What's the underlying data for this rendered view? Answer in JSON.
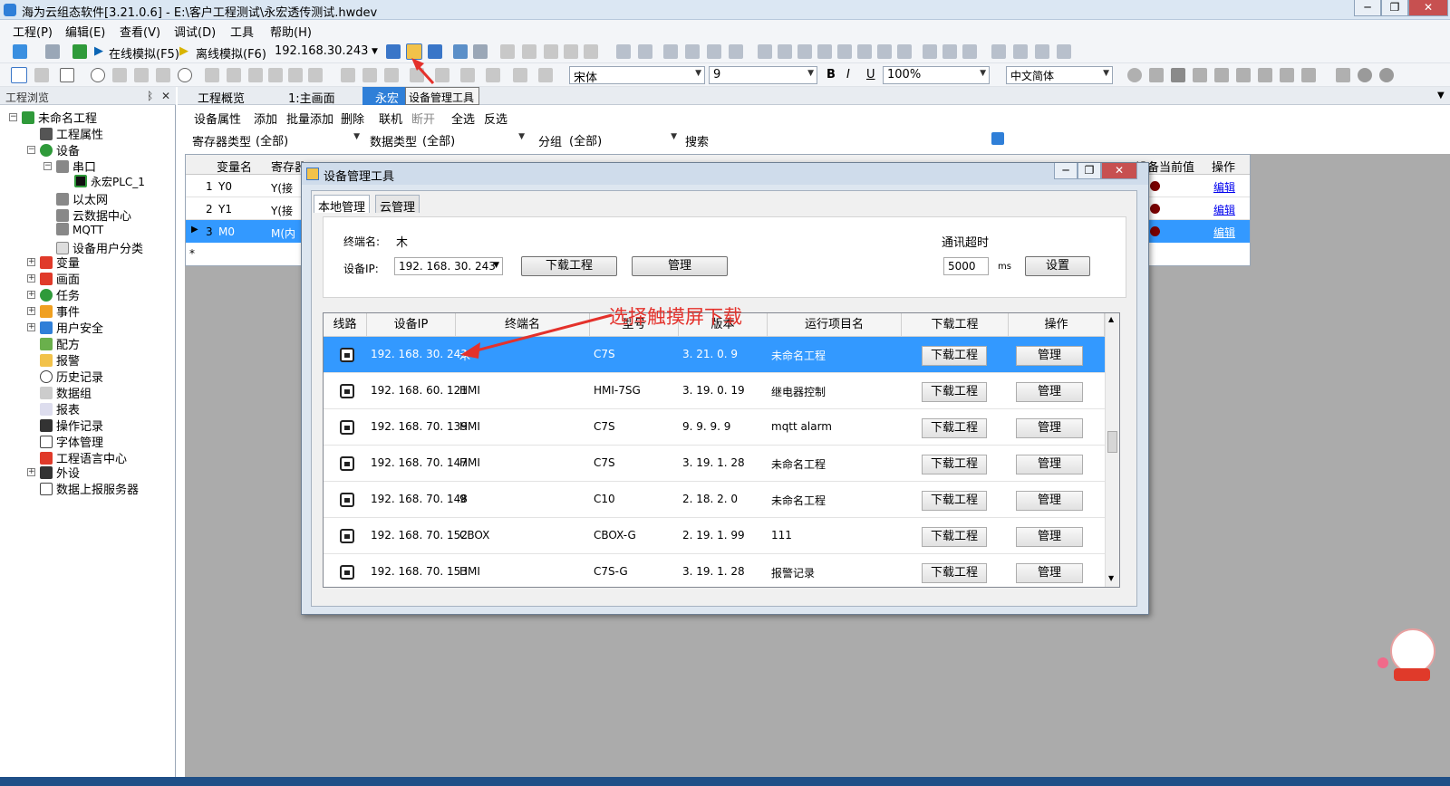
{
  "app": {
    "title": "海为云组态软件[3.21.0.6] - E:\\客户工程测试\\永宏透传测试.hwdev"
  },
  "menu": [
    "工程(P)",
    "编辑(E)",
    "查看(V)",
    "调试(D)",
    "工具",
    "帮助(H)"
  ],
  "toolbar": {
    "online_sim": "在线模拟(F5)",
    "offline_sim": "离线模拟(F6)",
    "ip": "192.168.30.243",
    "font_name": "宋体",
    "font_size": "9",
    "zoom": "100%",
    "language": "中文简体",
    "tooltip": "设备管理工具"
  },
  "left_panel": {
    "title": "工程浏览",
    "tree": [
      "未命名工程",
      "工程属性",
      "设备",
      "串口",
      "永宏PLC_1",
      "以太网",
      "云数据中心",
      "MQTT",
      "设备用户分类",
      "变量",
      "画面",
      "任务",
      "事件",
      "用户安全",
      "配方",
      "报警",
      "历史记录",
      "数据组",
      "报表",
      "操作记录",
      "字体管理",
      "工程语言中心",
      "外设",
      "数据上报服务器"
    ]
  },
  "doc_tabs": [
    "工程概览",
    "1:主画面",
    "永宏"
  ],
  "device_toolbar": [
    "设备属性",
    "添加",
    "批量添加",
    "删除",
    "联机",
    "断开",
    "全选",
    "反选"
  ],
  "filters": {
    "reg_type_label": "寄存器类型",
    "reg_type_value": "(全部)",
    "data_type_label": "数据类型",
    "data_type_value": "(全部)",
    "group_label": "分组",
    "group_value": "(全部)",
    "search_label": "搜索"
  },
  "var_grid": {
    "headers": [
      "变量名",
      "寄存器类型",
      "设备当前值",
      "操作"
    ],
    "rows": [
      {
        "no": "1",
        "name": "Y0",
        "reg": "Y(接",
        "op": "编辑"
      },
      {
        "no": "2",
        "name": "Y1",
        "reg": "Y(接",
        "op": "编辑"
      },
      {
        "no": "3",
        "name": "M0",
        "reg": "M(内",
        "op": "编辑"
      }
    ],
    "new_row_marker": "*"
  },
  "dialog": {
    "title": "设备管理工具",
    "tabs": [
      "本地管理",
      "云管理"
    ],
    "terminal_name_label": "终端名:",
    "terminal_name": "木",
    "device_ip_label": "设备IP:",
    "device_ip": "192. 168. 30. 243",
    "download_btn": "下载工程",
    "manage_btn": "管理",
    "timeout_label": "通讯超时",
    "timeout_value": "5000",
    "timeout_unit": "ms",
    "set_btn": "设置",
    "list_headers": [
      "线路",
      "设备IP",
      "终端名",
      "型号",
      "版本",
      "运行项目名",
      "下载工程",
      "操作"
    ],
    "devices": [
      {
        "ip": "192. 168. 30. 243",
        "name": "木",
        "model": "C7S",
        "version": "3. 21. 0. 9",
        "project": "未命名工程",
        "download": "下载工程",
        "manage": "管理"
      },
      {
        "ip": "192. 168. 60. 121",
        "name": "HMI",
        "model": "HMI-7SG",
        "version": "3. 19. 0. 19",
        "project": "继电器控制",
        "download": "下载工程",
        "manage": "管理"
      },
      {
        "ip": "192. 168. 70. 139",
        "name": "HMI",
        "model": "C7S",
        "version": "9. 9. 9. 9",
        "project": "mqtt alarm",
        "download": "下载工程",
        "manage": "管理"
      },
      {
        "ip": "192. 168. 70. 147",
        "name": "HMI",
        "model": "C7S",
        "version": "3. 19. 1. 28",
        "project": "未命名工程",
        "download": "下载工程",
        "manage": "管理"
      },
      {
        "ip": "192. 168. 70. 148",
        "name": "9",
        "model": "C10",
        "version": "2. 18. 2. 0",
        "project": "未命名工程",
        "download": "下载工程",
        "manage": "管理"
      },
      {
        "ip": "192. 168. 70. 152",
        "name": "CBOX",
        "model": "CBOX-G",
        "version": "2. 19. 1. 99",
        "project": "111",
        "download": "下载工程",
        "manage": "管理"
      },
      {
        "ip": "192. 168. 70. 153",
        "name": "HMI",
        "model": "C7S-G",
        "version": "3. 19. 1. 28",
        "project": "报警记录",
        "download": "下载工程",
        "manage": "管理"
      }
    ]
  },
  "annotation": "选择触摸屏下载",
  "colors": {
    "selection": "#3399ff",
    "annotation": "#e4312b",
    "workspace": "#ababab"
  }
}
